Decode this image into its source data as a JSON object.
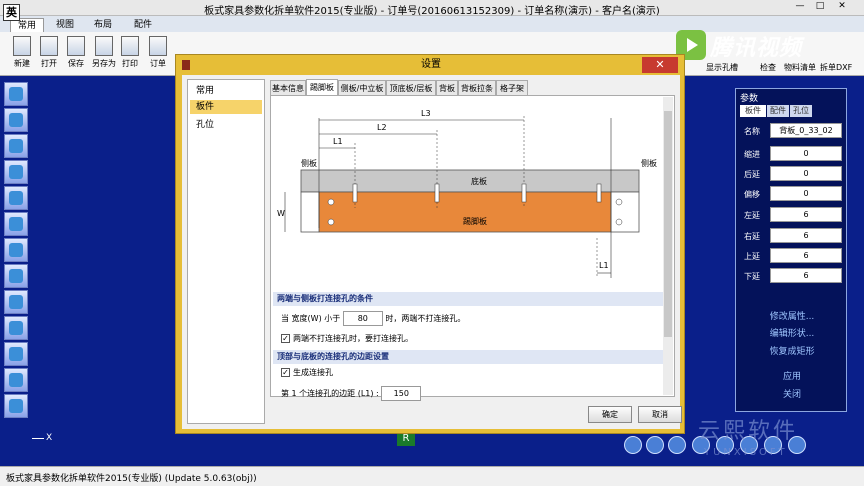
{
  "app": {
    "title": "板式家具参数化拆单软件2015(专业版) - 订单号(20160613152309) - 订单名称(演示) - 客户名(演示)",
    "ime": "英"
  },
  "ribbon_tabs": [
    "常用",
    "视图",
    "布局",
    "配件"
  ],
  "toolbar_left": [
    "新建",
    "打开",
    "保存",
    "另存为",
    "打印",
    "订单"
  ],
  "toolbar_right": [
    "显示孔槽",
    "检查",
    "物料清单",
    "拆单DXF"
  ],
  "logo_text": "腾讯视频",
  "dialog": {
    "title": "设置",
    "close": "✕",
    "nav": [
      "常用",
      "板件",
      "孔位"
    ],
    "tabs": [
      "基本信息",
      "踢脚板",
      "侧板/中立板",
      "顶底板/层板",
      "背板",
      "背板拉条",
      "格子架"
    ],
    "diagram": {
      "labels": {
        "l3": "L3",
        "l2": "L2",
        "l1_top": "L1",
        "l1_bottom": "L1",
        "side_left": "侧板",
        "side_right": "侧板",
        "bottom_board": "底板",
        "kick_board": "踢脚板",
        "w": "W"
      }
    },
    "section1": {
      "title": "两端与侧板打连接孔的条件",
      "line_prefix": "当 宽度(W) 小于",
      "width_value": "80",
      "line_suffix": "时，两端不打连接孔。",
      "check_label": "两端不打连接孔时，要打连接孔。"
    },
    "section2": {
      "title": "顶部与底板的连接孔的边距设置",
      "check_label": "生成连接孔",
      "edge_prefix": "第 1 个连接孔的边距 (L1) :",
      "edge_value": "150"
    },
    "ok": "确定",
    "cancel": "取消"
  },
  "params": {
    "header": "参数",
    "tabs": [
      "板件",
      "配件",
      "孔位"
    ],
    "rows": [
      {
        "k": "名称",
        "v": "背板_0_33_02"
      },
      {
        "k": "缩进",
        "v": "0"
      },
      {
        "k": "后延",
        "v": "0"
      },
      {
        "k": "偏移",
        "v": "0"
      },
      {
        "k": "左延",
        "v": "6"
      },
      {
        "k": "右延",
        "v": "6"
      },
      {
        "k": "上延",
        "v": "6"
      },
      {
        "k": "下延",
        "v": "6"
      }
    ],
    "links": [
      "修改属性...",
      "编辑形状...",
      "恢复成矩形",
      "应用",
      "关闭"
    ]
  },
  "axis_label": "X",
  "r_marker": "R",
  "watermark": "云熙软件",
  "watermark_sub": "YUNXISOFT",
  "status": "板式家具参数化拆单软件2015(专业版) (Update 5.0.63(obj))"
}
